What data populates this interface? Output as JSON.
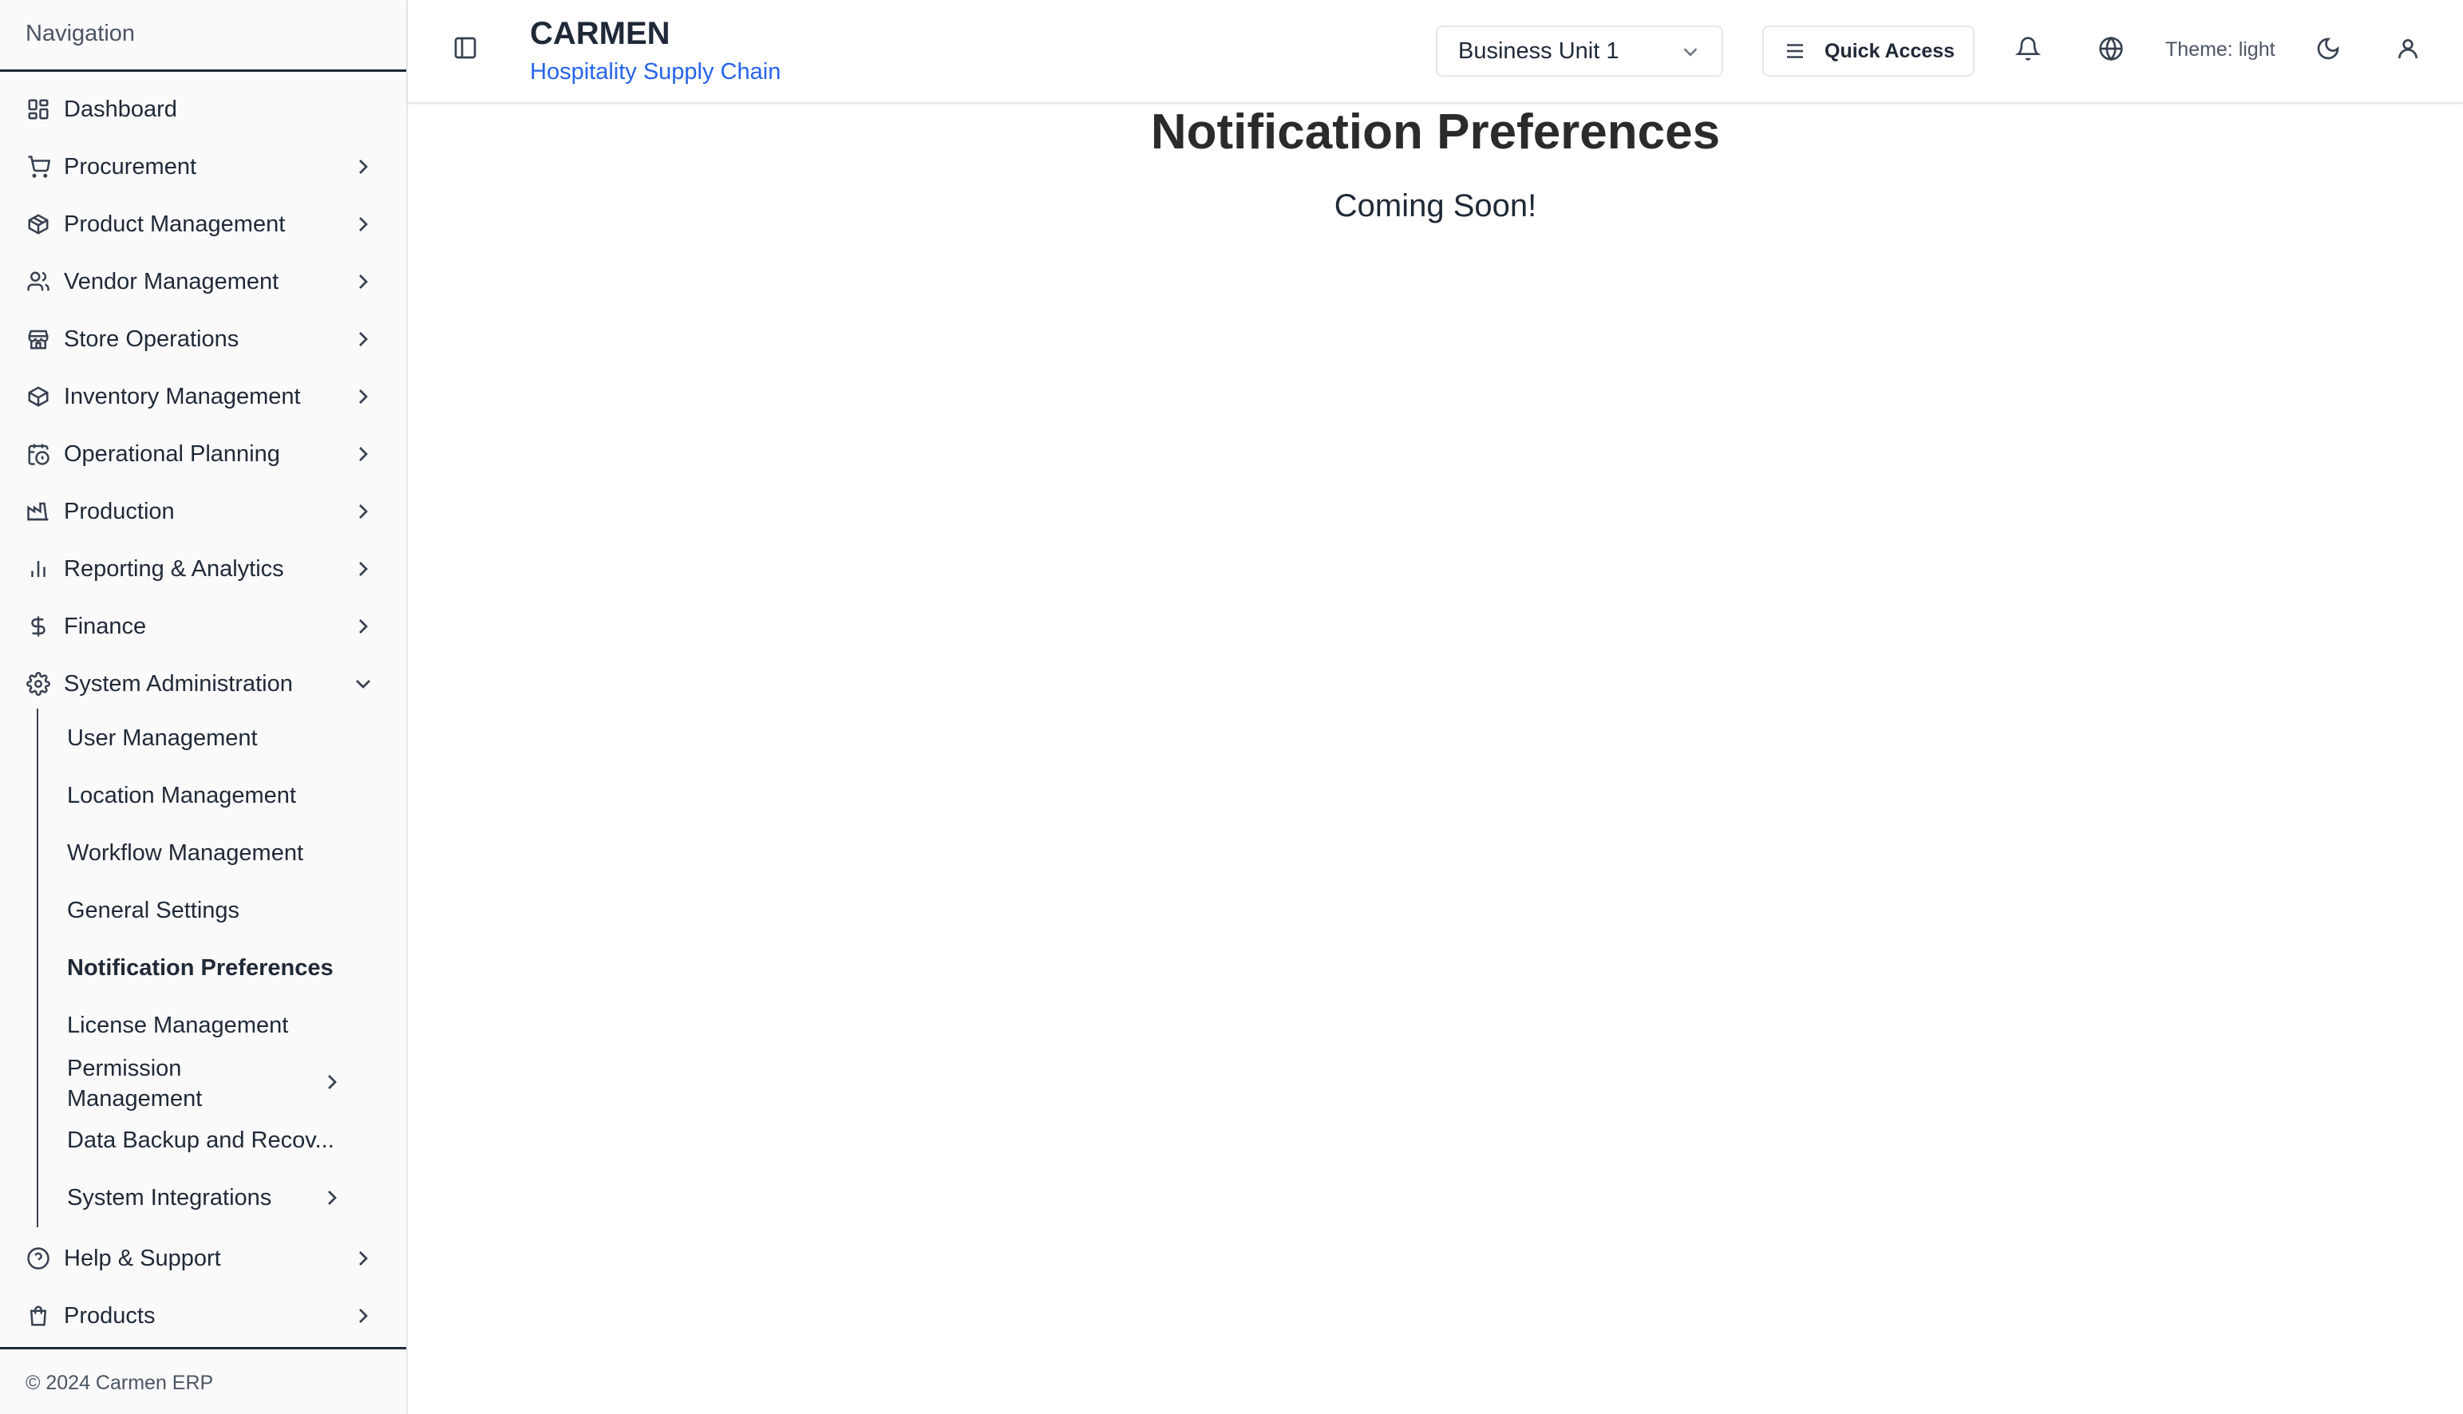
{
  "sidebar": {
    "header": "Navigation",
    "items": [
      {
        "label": "Dashboard",
        "icon": "dashboard-icon"
      },
      {
        "label": "Procurement",
        "icon": "cart-icon"
      },
      {
        "label": "Product Management",
        "icon": "package-icon"
      },
      {
        "label": "Vendor Management",
        "icon": "users-icon"
      },
      {
        "label": "Store Operations",
        "icon": "store-icon"
      },
      {
        "label": "Inventory Management",
        "icon": "box-icon"
      },
      {
        "label": "Operational Planning",
        "icon": "calendar-clock-icon"
      },
      {
        "label": "Production",
        "icon": "factory-icon"
      },
      {
        "label": "Reporting & Analytics",
        "icon": "bar-chart-icon"
      },
      {
        "label": "Finance",
        "icon": "dollar-icon"
      },
      {
        "label": "System Administration",
        "icon": "gear-icon"
      }
    ],
    "sub_items": [
      {
        "label": "User Management"
      },
      {
        "label": "Location Management"
      },
      {
        "label": "Workflow Management"
      },
      {
        "label": "General Settings"
      },
      {
        "label": "Notification Preferences"
      },
      {
        "label": "License Management"
      },
      {
        "label": "Permission Management"
      },
      {
        "label": "Data Backup and Recov..."
      },
      {
        "label": "System Integrations"
      }
    ],
    "bottom_items": [
      {
        "label": "Help & Support",
        "icon": "help-circle-icon"
      },
      {
        "label": "Products",
        "icon": "shopping-bag-icon"
      }
    ],
    "footer": "© 2024 Carmen ERP"
  },
  "header": {
    "title": "CARMEN",
    "subtitle": "Hospitality Supply Chain",
    "business_unit": "Business Unit 1",
    "quick_access": "Quick Access",
    "theme_label": "Theme: light"
  },
  "main": {
    "title": "Notification Preferences",
    "subtitle": "Coming Soon!"
  },
  "colors": {
    "accent": "#2563eb",
    "text": "#1f2937"
  }
}
